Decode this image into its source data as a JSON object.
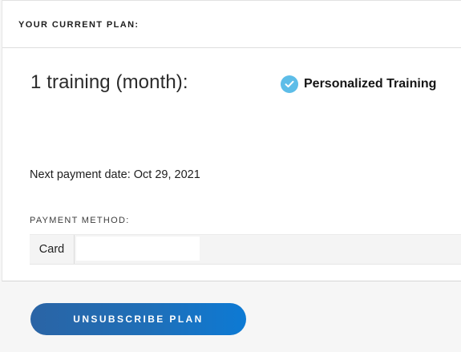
{
  "plan_card": {
    "header_title": "YOUR CURRENT PLAN:",
    "plan_name": "1 training (month):",
    "feature": {
      "icon": "check-circle-icon",
      "label": "Personalized Training"
    },
    "next_payment": "Next payment date: Oct 29, 2021",
    "payment_method": {
      "label": "PAYMENT METHOD:",
      "type": "Card",
      "value": ""
    }
  },
  "actions": {
    "unsubscribe_label": "UNSUBSCRIBE PLAN"
  },
  "colors": {
    "accent_check": "#5dbde8",
    "button_gradient_start": "#2a64a5",
    "button_gradient_end": "#0d7ad4",
    "page_background": "#f6f6f6"
  }
}
